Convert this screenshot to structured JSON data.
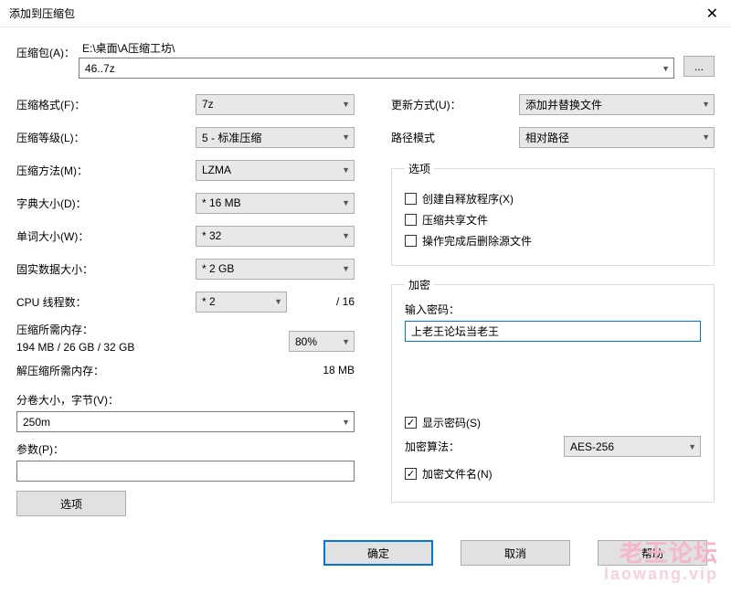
{
  "window": {
    "title": "添加到压缩包",
    "close": "✕"
  },
  "archive": {
    "label": "压缩包(A)：",
    "path": "E:\\桌面\\A压缩工坊\\",
    "name": "46..7z",
    "browse": "..."
  },
  "left": {
    "format": {
      "label": "压缩格式(F)：",
      "value": "7z"
    },
    "level": {
      "label": "压缩等级(L)：",
      "value": "5 - 标准压缩"
    },
    "method": {
      "label": "压缩方法(M)：",
      "value": "LZMA"
    },
    "dict": {
      "label": "字典大小(D)：",
      "value": "* 16 MB"
    },
    "word": {
      "label": "单词大小(W)：",
      "value": "* 32"
    },
    "solid": {
      "label": "固实数据大小：",
      "value": "* 2 GB"
    },
    "cpu": {
      "label": "CPU 线程数：",
      "value": "* 2",
      "of_total": "/ 16"
    },
    "mem_comp": {
      "label": "压缩所需内存：",
      "percent": "80%",
      "value": "194 MB / 26 GB / 32 GB"
    },
    "mem_decomp": {
      "label": "解压缩所需内存：",
      "value": "18 MB"
    },
    "split": {
      "label": "分卷大小，字节(V)：",
      "value": "250m"
    },
    "params": {
      "label": "参数(P)：",
      "value": ""
    },
    "options_btn": "选项"
  },
  "right": {
    "update": {
      "label": "更新方式(U)：",
      "value": "添加并替换文件"
    },
    "pathmode": {
      "label": "路径模式",
      "value": "相对路径"
    },
    "options": {
      "legend": "选项",
      "sfx": "创建自释放程序(X)",
      "shared": "压缩共享文件",
      "delete_after": "操作完成后删除源文件"
    },
    "encrypt": {
      "legend": "加密",
      "pw_label": "输入密码：",
      "pw_value": "上老王论坛当老王",
      "show_pw": "显示密码(S)",
      "algo_label": "加密算法：",
      "algo_value": "AES-256",
      "encrypt_names": "加密文件名(N)"
    }
  },
  "footer": {
    "ok": "确定",
    "cancel": "取消",
    "help": "帮助"
  },
  "watermark": {
    "line1": "老王论坛",
    "line2": "laowang.vip"
  }
}
